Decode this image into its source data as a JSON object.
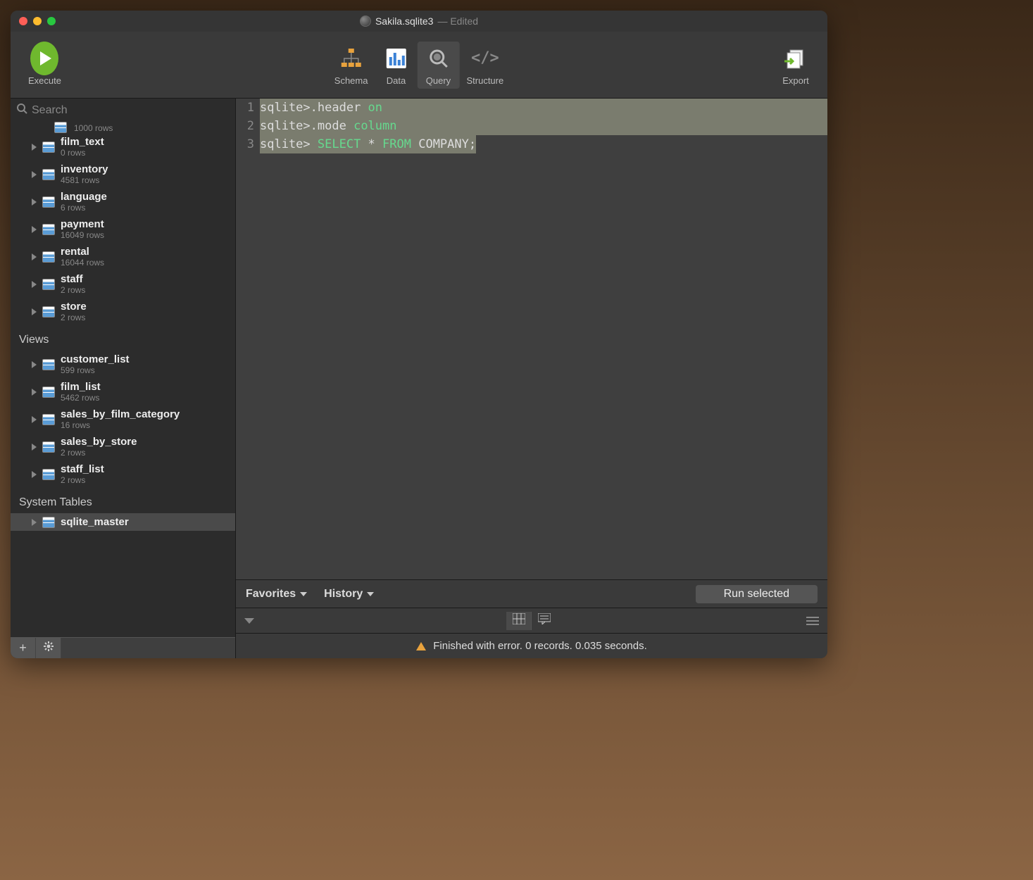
{
  "title": "Sakila.sqlite3",
  "title_suffix": " — Edited",
  "toolbar": {
    "execute": "Execute",
    "schema": "Schema",
    "data": "Data",
    "query": "Query",
    "structure": "Structure",
    "export": "Export"
  },
  "search": {
    "placeholder": "Search"
  },
  "sidebar": {
    "partial_rows": "1000 rows",
    "tables": [
      {
        "name": "film_text",
        "rows": "0 rows"
      },
      {
        "name": "inventory",
        "rows": "4581 rows"
      },
      {
        "name": "language",
        "rows": "6 rows"
      },
      {
        "name": "payment",
        "rows": "16049 rows"
      },
      {
        "name": "rental",
        "rows": "16044 rows"
      },
      {
        "name": "staff",
        "rows": "2 rows"
      },
      {
        "name": "store",
        "rows": "2 rows"
      }
    ],
    "views_label": "Views",
    "views": [
      {
        "name": "customer_list",
        "rows": "599 rows"
      },
      {
        "name": "film_list",
        "rows": "5462 rows"
      },
      {
        "name": "sales_by_film_category",
        "rows": "16 rows"
      },
      {
        "name": "sales_by_store",
        "rows": "2 rows"
      },
      {
        "name": "staff_list",
        "rows": "2 rows"
      }
    ],
    "system_label": "System Tables",
    "system": [
      {
        "name": "sqlite_master"
      }
    ]
  },
  "editor": {
    "lines": [
      {
        "n": "1",
        "prompt": "sqlite>",
        "cmd": ".header ",
        "kw": "on",
        "sel": true
      },
      {
        "n": "2",
        "prompt": "sqlite>",
        "cmd": ".mode ",
        "kw": "column",
        "sel": true
      },
      {
        "n": "3",
        "prompt": "sqlite> ",
        "kw1": "SELECT",
        "mid": " * ",
        "kw2": "FROM",
        "arg": " COMPANY;",
        "sel": false
      }
    ]
  },
  "favbar": {
    "favorites": "Favorites",
    "history": "History",
    "run_selected": "Run selected"
  },
  "status": "Finished with error. 0 records. 0.035 seconds."
}
